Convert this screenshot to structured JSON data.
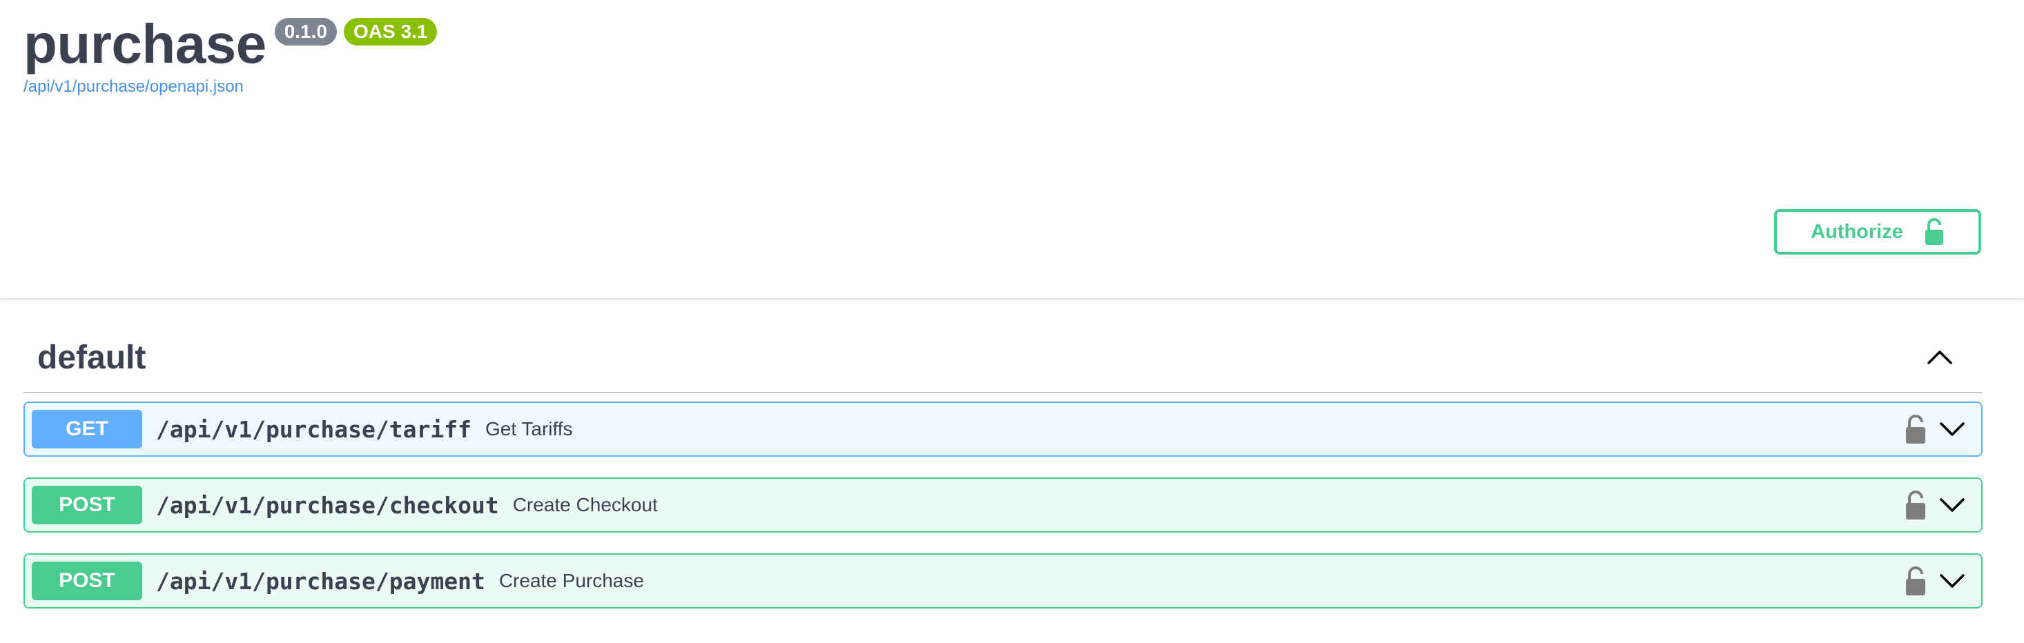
{
  "info": {
    "title": "purchase",
    "version": "0.1.0",
    "oas_version": "OAS 3.1",
    "spec_link": "/api/v1/purchase/openapi.json"
  },
  "authorize": {
    "label": "Authorize",
    "icon": "unlocked-lock-icon"
  },
  "tag": {
    "name": "default",
    "toggle_icon": "chevron-up-icon"
  },
  "operations": [
    {
      "method": "GET",
      "path": "/api/v1/purchase/tariff",
      "summary": "Get Tariffs"
    },
    {
      "method": "POST",
      "path": "/api/v1/purchase/checkout",
      "summary": "Create Checkout"
    },
    {
      "method": "POST",
      "path": "/api/v1/purchase/payment",
      "summary": "Create Purchase"
    }
  ],
  "colors": {
    "get": "#61affe",
    "post": "#49cc90",
    "authorize": "#49cc90",
    "version_badge": "#7d8492",
    "oas_badge": "#89bf04",
    "link": "#4990e2",
    "text": "#3b4151"
  }
}
